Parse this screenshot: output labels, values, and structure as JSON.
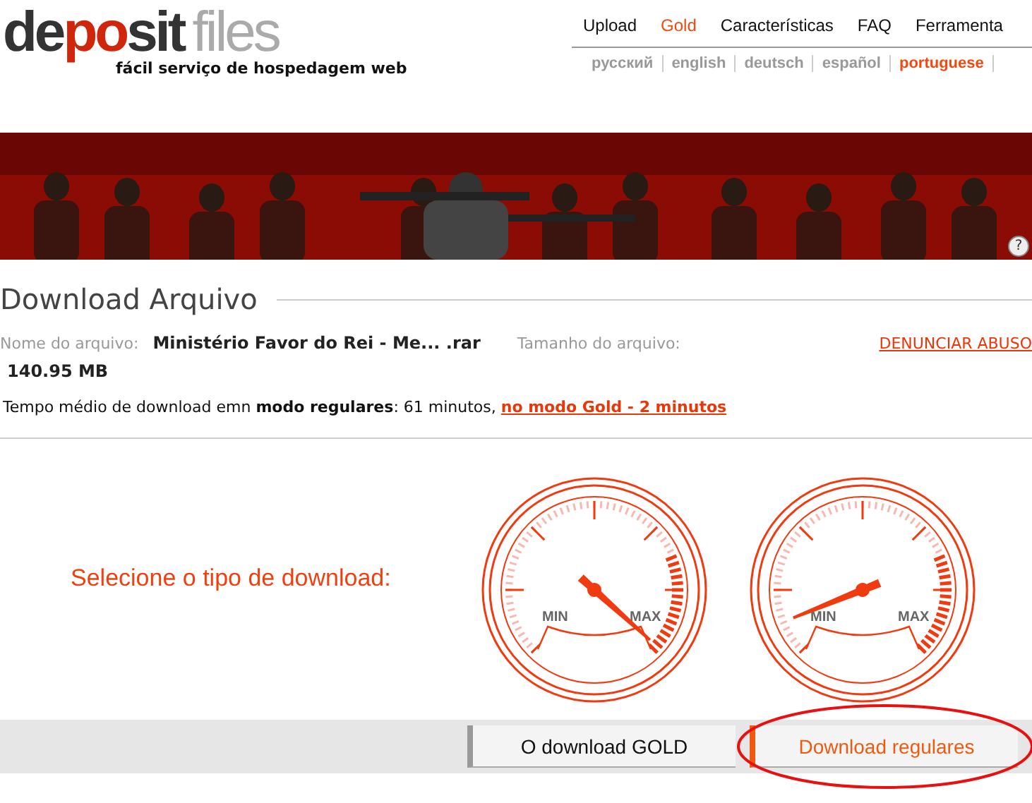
{
  "logo": {
    "parts": [
      {
        "text": "de",
        "kind": "dark"
      },
      {
        "text": "po",
        "kind": "accent"
      },
      {
        "text": "sit",
        "kind": "dark"
      },
      {
        "text": "files",
        "kind": "light"
      }
    ],
    "tagline": "fácil serviço de hospedagem web"
  },
  "nav": [
    {
      "label": "Upload",
      "selected": false
    },
    {
      "label": "Gold",
      "selected": true
    },
    {
      "label": "Características",
      "selected": false
    },
    {
      "label": "FAQ",
      "selected": false
    },
    {
      "label": "Ferramenta",
      "selected": false
    }
  ],
  "languages": [
    {
      "label": "русский",
      "selected": false
    },
    {
      "label": "english",
      "selected": false
    },
    {
      "label": "deutsch",
      "selected": false
    },
    {
      "label": "español",
      "selected": false
    },
    {
      "label": "portuguese",
      "selected": true
    }
  ],
  "banner": {
    "kind": "picture",
    "help": "?"
  },
  "heading": "Download Arquivo",
  "file": {
    "name_label": "Nome do arquivo:",
    "name": "Ministério Favor do Rei - Me... .rar",
    "size_label": "Tamanho do arquivo:",
    "size": "140.95 MB",
    "report": "DENUNCIAR ABUSO"
  },
  "time_text": "Tempo médio de download emn **modo regulares**: 61 minutos, ",
  "time_link": "no modo Gold - 2 minutos",
  "prompt": "Selecione o tipo de download:",
  "gauges": [
    {
      "min": "MIN",
      "max": "MAX",
      "kind": "fast"
    },
    {
      "min": "MIN",
      "max": "MAX",
      "kind": "slow"
    }
  ],
  "buttons": [
    {
      "label": "O download GOLD",
      "selected": false
    },
    {
      "label": "Download regulares",
      "selected": true
    }
  ]
}
